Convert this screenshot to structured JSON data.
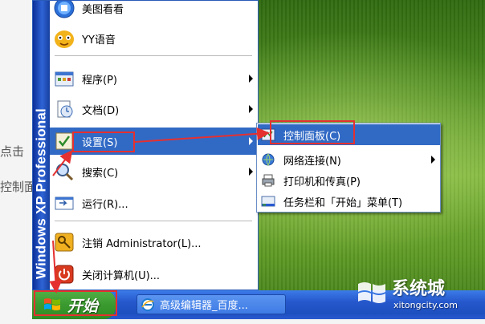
{
  "background_page": {
    "fragment_1": "点击",
    "fragment_2": "控制面"
  },
  "start_menu": {
    "side_banner": "Windows XP Professional",
    "items": [
      {
        "label": "美图看看",
        "icon": "meitu-viewer-icon",
        "submenu": false
      },
      {
        "label": "YY语音",
        "icon": "yy-voice-icon",
        "submenu": false
      },
      {
        "label": "程序(P)",
        "icon": "programs-icon",
        "submenu": true
      },
      {
        "label": "文档(D)",
        "icon": "documents-icon",
        "submenu": true
      },
      {
        "label": "设置(S)",
        "icon": "settings-icon",
        "submenu": true,
        "selected": true
      },
      {
        "label": "搜索(C)",
        "icon": "search-icon",
        "submenu": true
      },
      {
        "label": "运行(R)...",
        "icon": "run-icon",
        "submenu": false
      },
      {
        "label": "注销 Administrator(L)...",
        "icon": "logoff-icon",
        "submenu": false
      },
      {
        "label": "关闭计算机(U)...",
        "icon": "shutdown-icon",
        "submenu": false
      }
    ]
  },
  "settings_submenu": {
    "items": [
      {
        "label": "控制面板(C)",
        "icon": "control-panel-icon",
        "selected": true
      },
      {
        "label": "网络连接(N)",
        "icon": "network-connections-icon",
        "submenu": true
      },
      {
        "label": "打印机和传真(P)",
        "icon": "printers-faxes-icon"
      },
      {
        "label": "任务栏和「开始」菜单(T)",
        "icon": "taskbar-start-menu-icon"
      }
    ]
  },
  "taskbar": {
    "start_label": "开始",
    "task_label": "高级编辑器_百度..."
  },
  "watermark": {
    "title": "系统城",
    "url": "xitongcity.com"
  },
  "colors": {
    "selection": "#316ac5",
    "annotation_red": "#e53030",
    "taskbar_blue": "#2658cc",
    "start_green": "#3a9a2f"
  }
}
